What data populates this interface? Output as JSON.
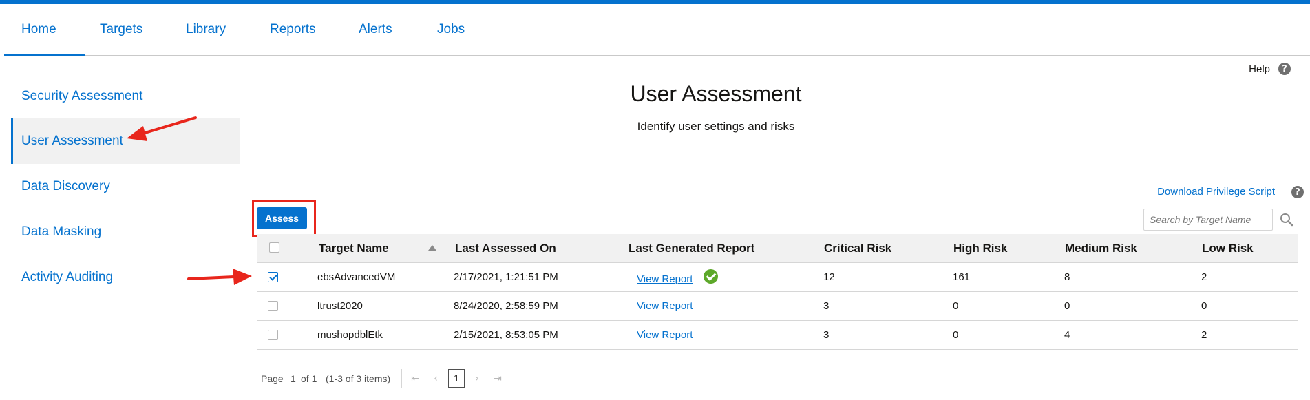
{
  "nav": {
    "tabs": [
      {
        "label": "Home",
        "active": true
      },
      {
        "label": "Targets"
      },
      {
        "label": "Library"
      },
      {
        "label": "Reports"
      },
      {
        "label": "Alerts"
      },
      {
        "label": "Jobs"
      }
    ]
  },
  "help": {
    "label": "Help",
    "icon": "question-icon"
  },
  "sidebar": {
    "items": [
      {
        "label": "Security Assessment"
      },
      {
        "label": "User Assessment",
        "active": true
      },
      {
        "label": "Data Discovery"
      },
      {
        "label": "Data Masking"
      },
      {
        "label": "Activity Auditing"
      }
    ]
  },
  "main": {
    "title": "User Assessment",
    "subtitle": "Identify user settings and risks",
    "download_link": "Download Privilege Script",
    "assess_label": "Assess",
    "search_placeholder": "Search by Target Name"
  },
  "table": {
    "columns": [
      "Target Name",
      "Last Assessed On",
      "Last Generated Report",
      "Critical Risk",
      "High Risk",
      "Medium Risk",
      "Low Risk"
    ],
    "rows": [
      {
        "checked": true,
        "target": "ebsAdvancedVM",
        "assessed": "2/17/2021, 1:21:51 PM",
        "report": "View Report",
        "report_ok": true,
        "critical": "12",
        "high": "161",
        "medium": "8",
        "low": "2"
      },
      {
        "checked": false,
        "target": "ltrust2020",
        "assessed": "8/24/2020, 2:58:59 PM",
        "report": "View Report",
        "report_ok": false,
        "critical": "3",
        "high": "0",
        "medium": "0",
        "low": "0"
      },
      {
        "checked": false,
        "target": "mushopdblEtk",
        "assessed": "2/15/2021, 8:53:05 PM",
        "report": "View Report",
        "report_ok": false,
        "critical": "3",
        "high": "0",
        "medium": "4",
        "low": "2"
      }
    ]
  },
  "pagination": {
    "page_label": "Page",
    "current_page": "1",
    "of_label": "of 1",
    "items_label": "(1-3 of 3 items)",
    "page_button": "1"
  },
  "colors": {
    "accent": "#0572ce",
    "highlight": "#e8261c",
    "success": "#5da82a"
  }
}
